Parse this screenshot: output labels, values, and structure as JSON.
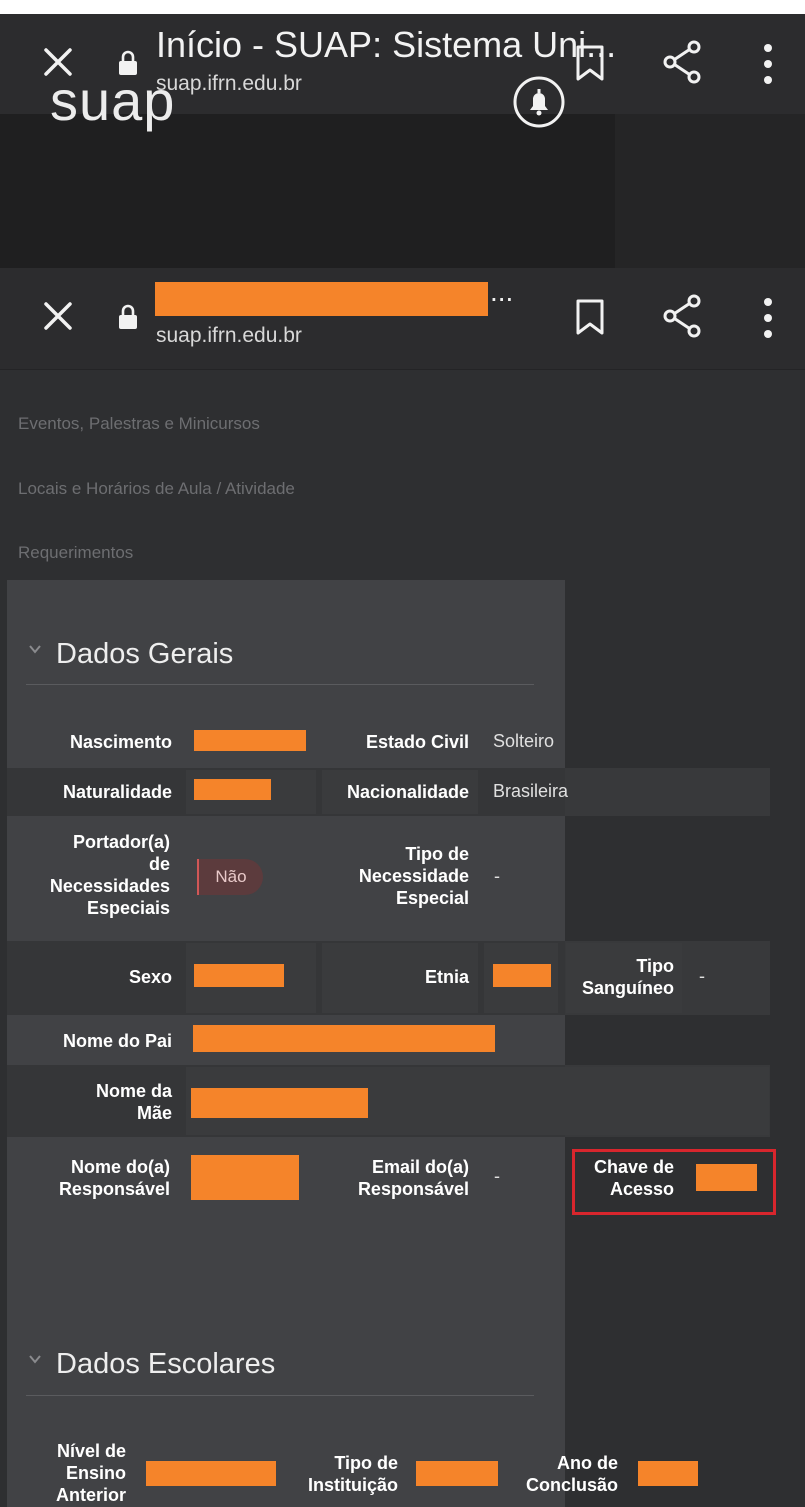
{
  "browser_top": {
    "title": "Início - SUAP: Sistema Uni...",
    "url": "suap.ifrn.edu.br"
  },
  "browser_second": {
    "ellipsis": "...",
    "url": "suap.ifrn.edu.br"
  },
  "app": {
    "logo": "suap"
  },
  "menu": {
    "items": [
      "Eventos, Palestras e Minicursos",
      "Locais e Horários de Aula / Atividade",
      "Requerimentos"
    ]
  },
  "dados_gerais": {
    "title": "Dados Gerais",
    "nascimento_label": "Nascimento",
    "estado_civil_label": "Estado Civil",
    "estado_civil_value": "Solteiro",
    "naturalidade_label": "Naturalidade",
    "nacionalidade_label": "Nacionalidade",
    "nacionalidade_value": "Brasileira",
    "portador_label": [
      "Portador(a)",
      "de",
      "Necessidades",
      "Especiais"
    ],
    "portador_value": "Não",
    "tipo_necessidade_label": [
      "Tipo de",
      "Necessidade",
      "Especial"
    ],
    "tipo_necessidade_value": "-",
    "sexo_label": "Sexo",
    "etnia_label": "Etnia",
    "tipo_sanguineo_label": [
      "Tipo",
      "Sanguíneo"
    ],
    "tipo_sanguineo_value": "-",
    "nome_pai_label": "Nome do Pai",
    "nome_mae_label": [
      "Nome da",
      "Mãe"
    ],
    "nome_responsavel_label": [
      "Nome do(a)",
      "Responsável"
    ],
    "email_responsavel_label": [
      "Email do(a)",
      "Responsável"
    ],
    "email_responsavel_value": "-",
    "chave_acesso_label": [
      "Chave de",
      "Acesso"
    ]
  },
  "dados_escolares": {
    "title": "Dados Escolares",
    "nivel_label": [
      "Nível de",
      "Ensino",
      "Anterior"
    ],
    "tipo_instituicao_label": [
      "Tipo de",
      "Instituição"
    ],
    "ano_conclusao_label": [
      "Ano de",
      "Conclusão"
    ]
  },
  "colors": {
    "redaction": "#f5842a",
    "highlight": "#d8262d",
    "badge_no": "#5c3b3d"
  },
  "icons": [
    "close-icon",
    "lock-icon",
    "bookmark-icon",
    "share-icon",
    "more-vert-icon",
    "bell-icon",
    "chevron-down-icon"
  ]
}
